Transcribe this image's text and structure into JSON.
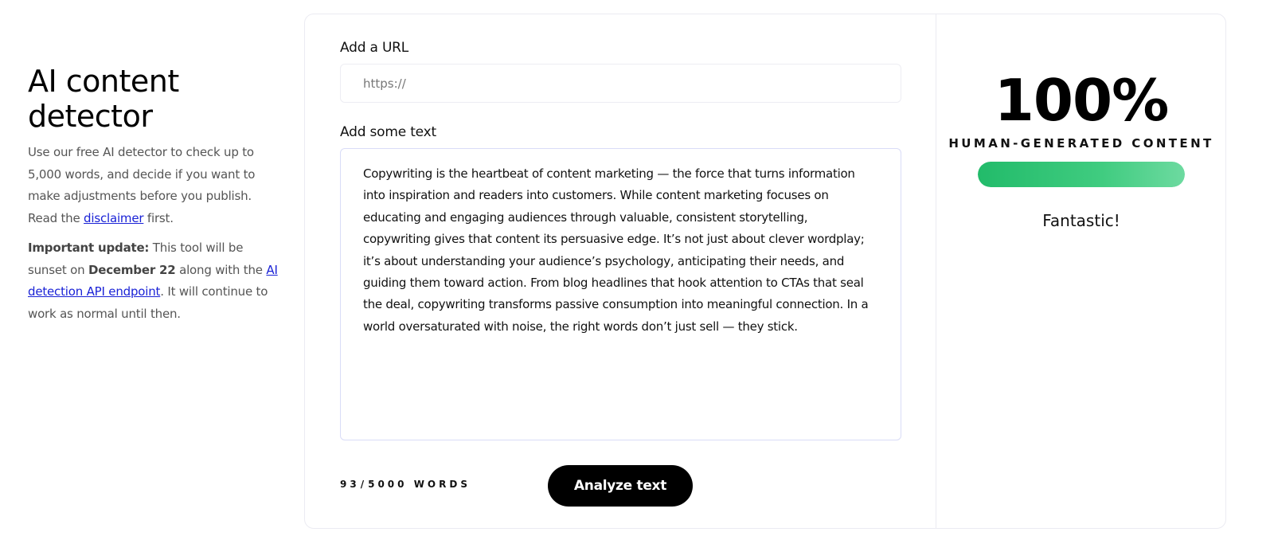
{
  "intro": {
    "title_line1": "AI content",
    "title_line2": "detector",
    "description": "Use our free AI detector to check up to 5,000 words, and decide if you want to make adjustments before you publish. Read the ",
    "disclaimer_link": "disclaimer",
    "description_end": " first.",
    "update_label": "Important update:",
    "update_text1": " This tool will be sunset on ",
    "update_date": "December 22",
    "update_text2": " along with the ",
    "api_link": "AI detection API endpoint",
    "update_text3": ". It will continue to work as normal until then."
  },
  "form": {
    "url_label": "Add a URL",
    "url_placeholder": "https://",
    "url_value": "",
    "text_label": "Add some text",
    "text_value": "Copywriting is the heartbeat of content marketing — the force that turns information into inspiration and readers into customers. While content marketing focuses on educating and engaging audiences through valuable, consistent storytelling, copywriting gives that content its persuasive edge. It’s not just about clever wordplay; it’s about understanding your audience’s psychology, anticipating their needs, and guiding them toward action. From blog headlines that hook attention to CTAs that seal the deal, copywriting transforms passive consumption into meaningful connection. In a world oversaturated with noise, the right words don’t just sell — they stick.",
    "word_count": "93",
    "word_limit": "5000",
    "word_unit": "WORDS",
    "analyze_label": "Analyze text"
  },
  "result": {
    "score": "100%",
    "verdict": "HUMAN-GENERATED CONTENT",
    "human_fraction": 1.0,
    "feedback": "Fantastic!"
  },
  "colors": {
    "accent_green": "#2cc070",
    "link_blue": "#1a22d6",
    "button_black": "#000000"
  }
}
